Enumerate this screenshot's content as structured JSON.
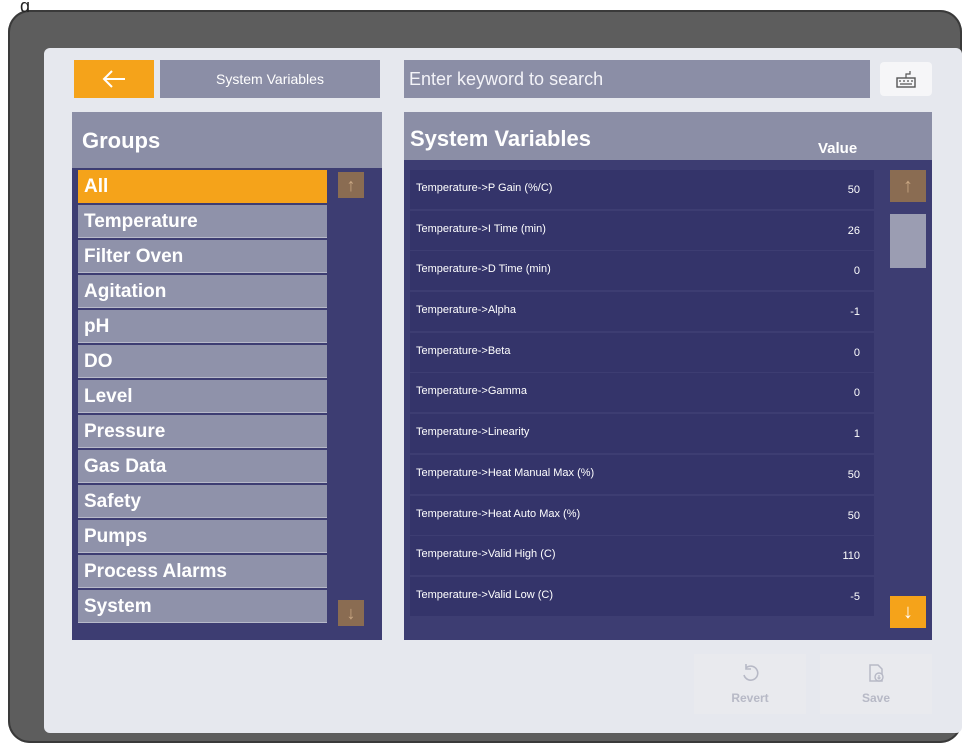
{
  "bezel_caption": "g",
  "topbar": {
    "back_icon": "arrow-left-icon",
    "title": "System Variables",
    "search_placeholder": "Enter keyword to search",
    "keyboard_icon": "keyboard-icon"
  },
  "groups": {
    "title": "Groups",
    "items": [
      {
        "label": "All",
        "active": true
      },
      {
        "label": "Temperature"
      },
      {
        "label": "Filter Oven"
      },
      {
        "label": "Agitation"
      },
      {
        "label": "pH"
      },
      {
        "label": "DO"
      },
      {
        "label": "Level"
      },
      {
        "label": "Pressure"
      },
      {
        "label": "Gas Data"
      },
      {
        "label": "Safety"
      },
      {
        "label": "Pumps"
      },
      {
        "label": "Process Alarms"
      },
      {
        "label": "System"
      }
    ]
  },
  "variables": {
    "title": "System Variables",
    "value_header": "Value",
    "rows": [
      {
        "name": "Temperature->P Gain (%/C)",
        "value": "50"
      },
      {
        "name": "Temperature->I Time (min)",
        "value": "26"
      },
      {
        "name": "Temperature->D Time (min)",
        "value": "0"
      },
      {
        "name": "Temperature->Alpha",
        "value": "-1"
      },
      {
        "name": "Temperature->Beta",
        "value": "0"
      },
      {
        "name": "Temperature->Gamma",
        "value": "0"
      },
      {
        "name": "Temperature->Linearity",
        "value": "1"
      },
      {
        "name": "Temperature->Heat Manual Max (%)",
        "value": "50"
      },
      {
        "name": "Temperature->Heat Auto Max (%)",
        "value": "50"
      },
      {
        "name": "Temperature->Valid High (C)",
        "value": "110"
      },
      {
        "name": "Temperature->Valid Low (C)",
        "value": "-5"
      }
    ]
  },
  "actions": {
    "revert": "Revert",
    "save": "Save"
  },
  "colors": {
    "accent": "#f5a31a",
    "panel": "#3d3d72",
    "header": "#8b8ea6"
  }
}
